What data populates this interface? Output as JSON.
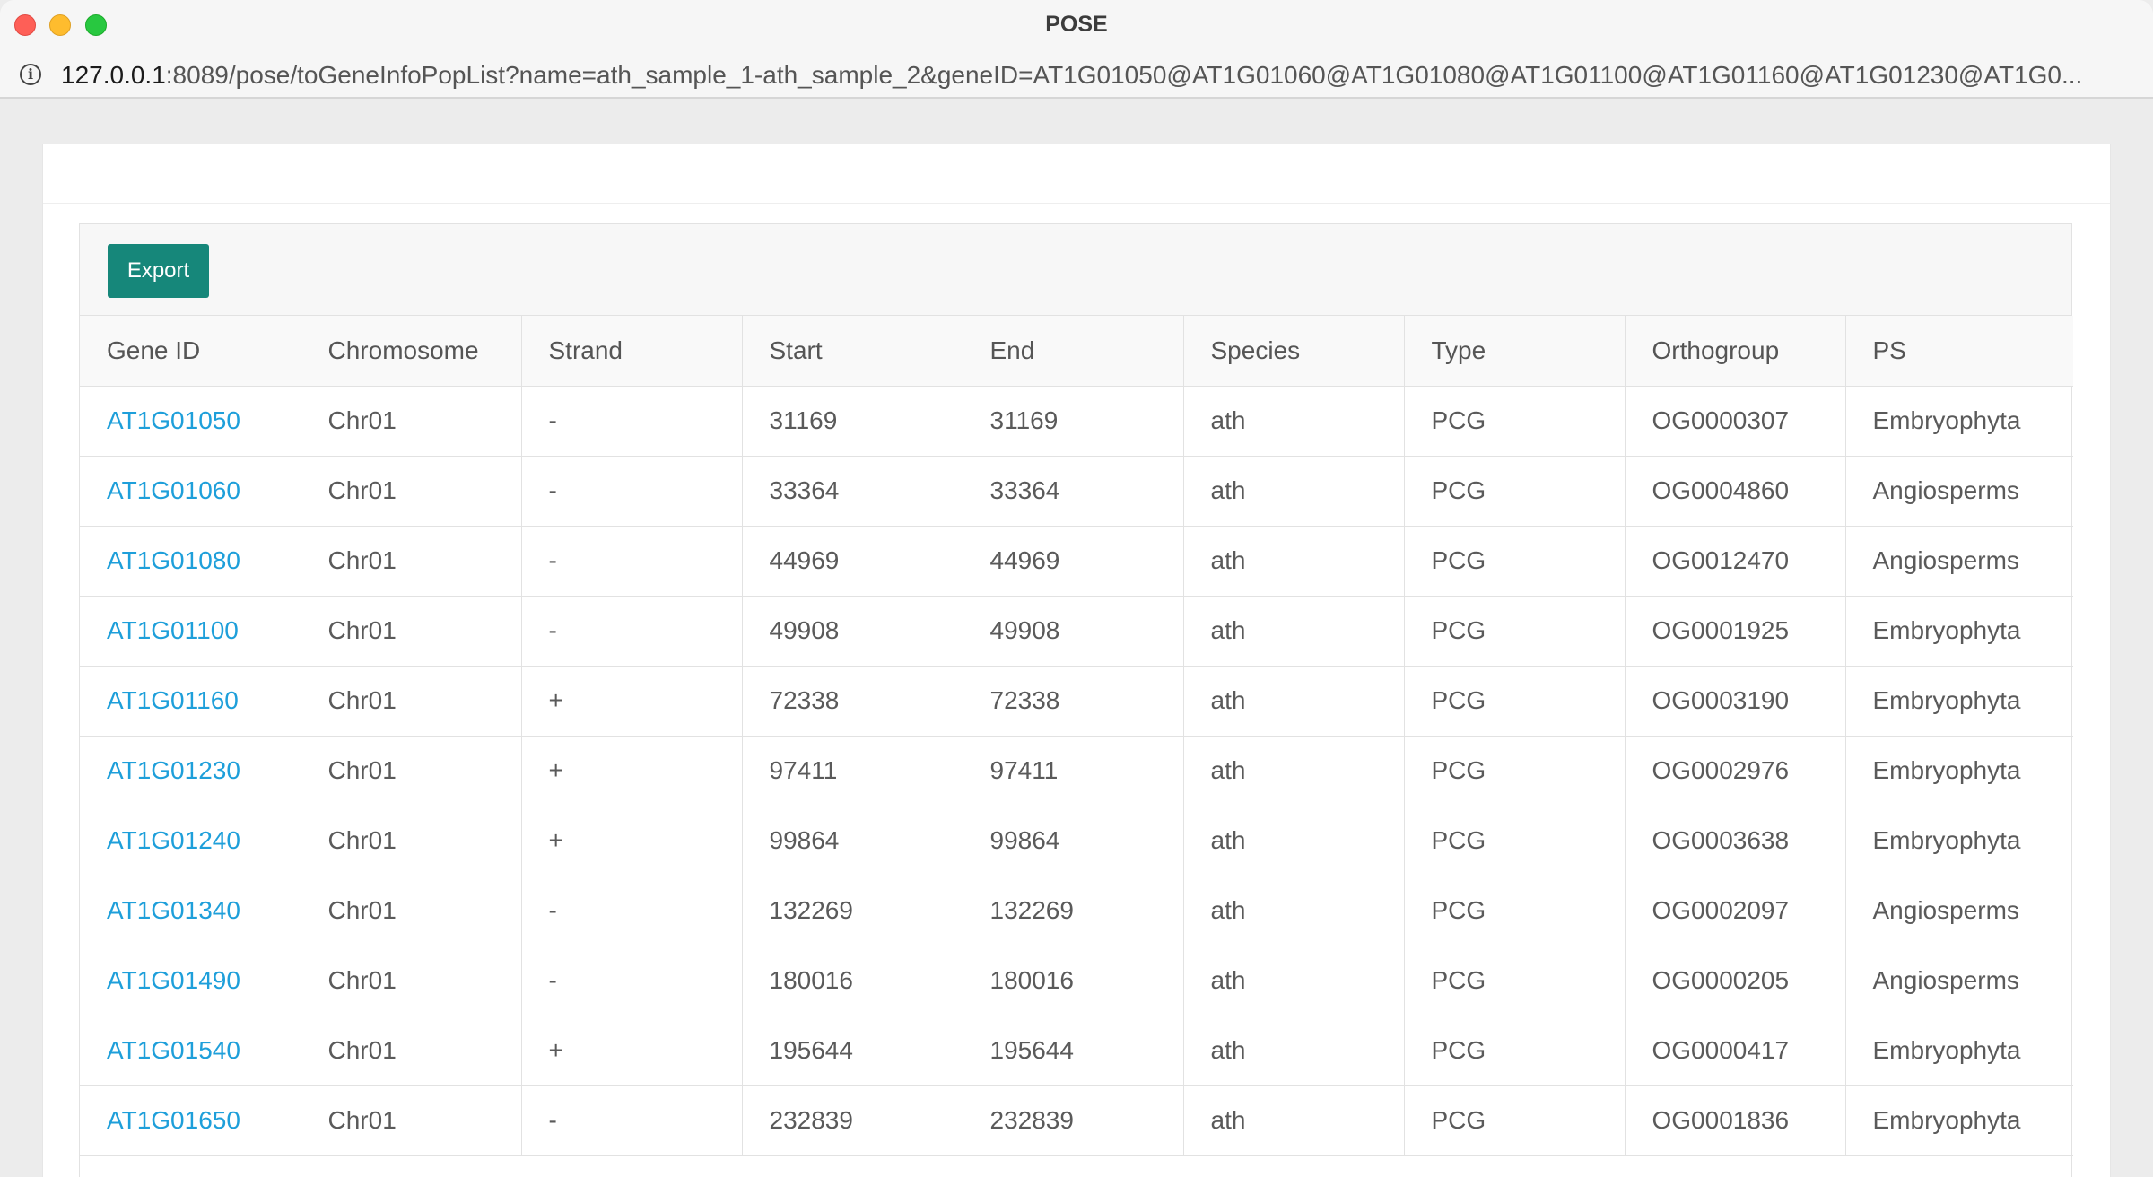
{
  "window": {
    "title": "POSE",
    "url_host": "127.0.0.1",
    "url_rest": ":8089/pose/toGeneInfoPopList?name=ath_sample_1-ath_sample_2&geneID=AT1G01050@AT1G01060@AT1G01080@AT1G01100@AT1G01160@AT1G01230@AT1G0..."
  },
  "toolbar": {
    "export_label": "Export"
  },
  "table": {
    "headers": [
      "Gene ID",
      "Chromosome",
      "Strand",
      "Start",
      "End",
      "Species",
      "Type",
      "Orthogroup",
      "PS"
    ],
    "rows": [
      [
        "AT1G01050",
        "Chr01",
        "-",
        "31169",
        "31169",
        "ath",
        "PCG",
        "OG0000307",
        "Embryophyta"
      ],
      [
        "AT1G01060",
        "Chr01",
        "-",
        "33364",
        "33364",
        "ath",
        "PCG",
        "OG0004860",
        "Angiosperms"
      ],
      [
        "AT1G01080",
        "Chr01",
        "-",
        "44969",
        "44969",
        "ath",
        "PCG",
        "OG0012470",
        "Angiosperms"
      ],
      [
        "AT1G01100",
        "Chr01",
        "-",
        "49908",
        "49908",
        "ath",
        "PCG",
        "OG0001925",
        "Embryophyta"
      ],
      [
        "AT1G01160",
        "Chr01",
        "+",
        "72338",
        "72338",
        "ath",
        "PCG",
        "OG0003190",
        "Embryophyta"
      ],
      [
        "AT1G01230",
        "Chr01",
        "+",
        "97411",
        "97411",
        "ath",
        "PCG",
        "OG0002976",
        "Embryophyta"
      ],
      [
        "AT1G01240",
        "Chr01",
        "+",
        "99864",
        "99864",
        "ath",
        "PCG",
        "OG0003638",
        "Embryophyta"
      ],
      [
        "AT1G01340",
        "Chr01",
        "-",
        "132269",
        "132269",
        "ath",
        "PCG",
        "OG0002097",
        "Angiosperms"
      ],
      [
        "AT1G01490",
        "Chr01",
        "-",
        "180016",
        "180016",
        "ath",
        "PCG",
        "OG0000205",
        "Angiosperms"
      ],
      [
        "AT1G01540",
        "Chr01",
        "+",
        "195644",
        "195644",
        "ath",
        "PCG",
        "OG0000417",
        "Embryophyta"
      ],
      [
        "AT1G01650",
        "Chr01",
        "-",
        "232839",
        "232839",
        "ath",
        "PCG",
        "OG0001836",
        "Embryophyta"
      ]
    ]
  },
  "colors": {
    "link": "#1e9fda",
    "export_button": "#16877a"
  }
}
